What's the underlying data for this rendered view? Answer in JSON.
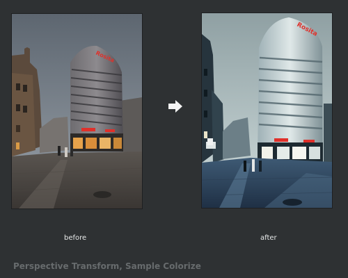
{
  "before_photo": {
    "caption": "before",
    "sign_text": "Rosita"
  },
  "after_photo": {
    "caption": "after",
    "sign_text": "Rosita"
  },
  "arrow": {
    "icon": "arrow-right-icon"
  },
  "footer": {
    "title": "Perspective Transform, Sample Colorize"
  },
  "colors": {
    "background": "#2e3133",
    "caption_text": "#e8eaea",
    "footer_text": "#676b6d",
    "sign_red": "#e0302a"
  }
}
